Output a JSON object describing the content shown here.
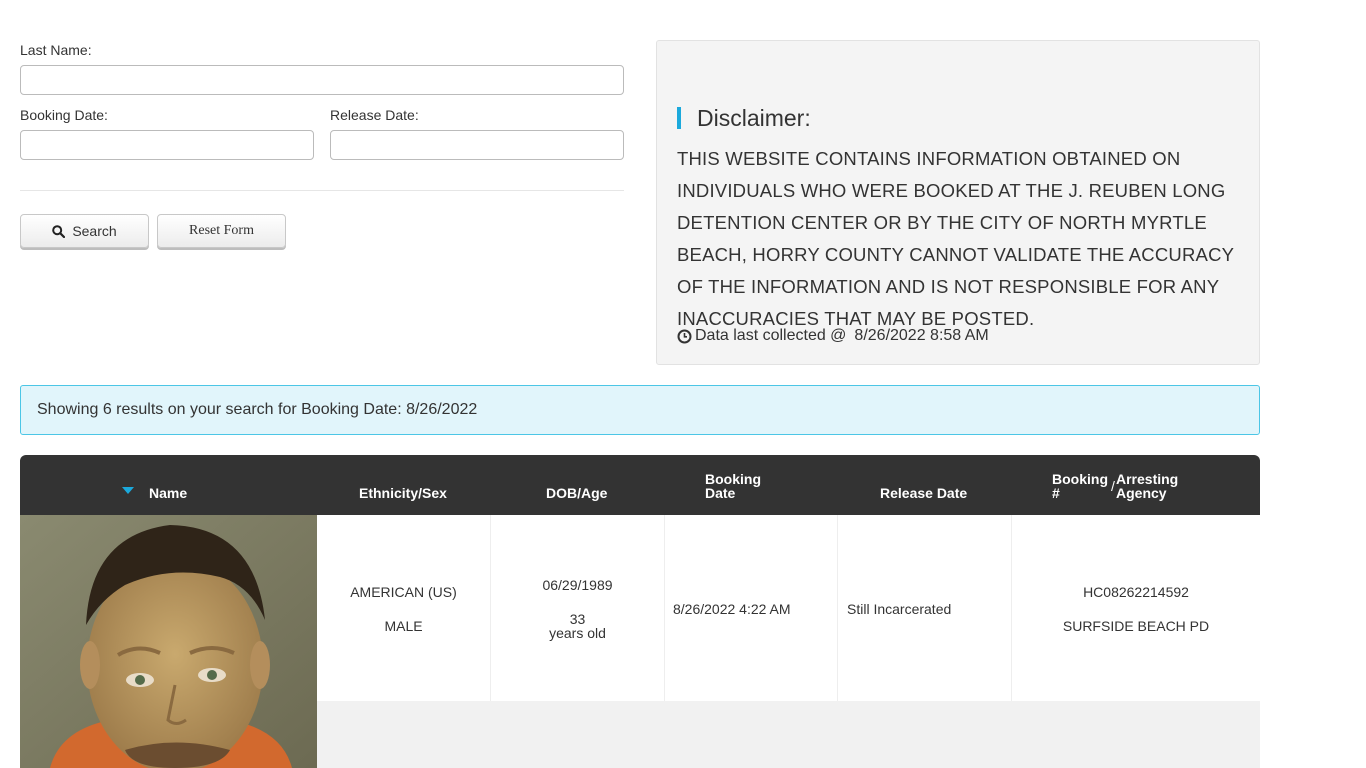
{
  "form": {
    "last_name_label": "Last Name:",
    "last_name_value": "",
    "booking_date_label": "Booking Date:",
    "booking_date_value": "",
    "release_date_label": "Release Date:",
    "release_date_value": "",
    "search_label": "Search",
    "reset_label": "Reset Form"
  },
  "disclaimer": {
    "heading": "Disclaimer:",
    "text": "This website contains information obtained on individuals who were booked at the J. Reuben Long Detention Center or by the City of North Myrtle Beach, Horry County cannot validate the accuracy of the information and is not responsible for any inaccuracies that may be posted.",
    "collected_label": "Data last collected @",
    "collected_value": "8/26/2022 8:58 AM"
  },
  "alert": {
    "text": "Showing 6 results on your search for Booking Date: 8/26/2022"
  },
  "table": {
    "headers": {
      "name": "Name",
      "ethnicity_sex": "Ethnicity/Sex",
      "dob_age": "DOB/Age",
      "booking_date": "Booking Date",
      "release_date": "Release Date",
      "booking_no": "Booking #",
      "separator": "/",
      "arresting_agency": "Arresting Agency"
    },
    "rows": [
      {
        "ethnicity": "AMERICAN (US)",
        "sex": "MALE",
        "dob": "06/29/1989",
        "age": "33",
        "age_suffix": "years old",
        "booking_date": "8/26/2022 4:22 AM",
        "release_date": "Still Incarcerated",
        "booking_no": "HC08262214592",
        "agency": "SURFSIDE BEACH PD"
      }
    ]
  },
  "colors": {
    "accent": "#1ba9dc",
    "header_bg": "#333333",
    "alert_bg": "#e1f5fb",
    "alert_border": "#4cc6e6",
    "panel_bg": "#f4f4f4"
  },
  "icons": {
    "search": "search-icon",
    "clock": "clock-icon",
    "sort": "sort-down-icon"
  }
}
